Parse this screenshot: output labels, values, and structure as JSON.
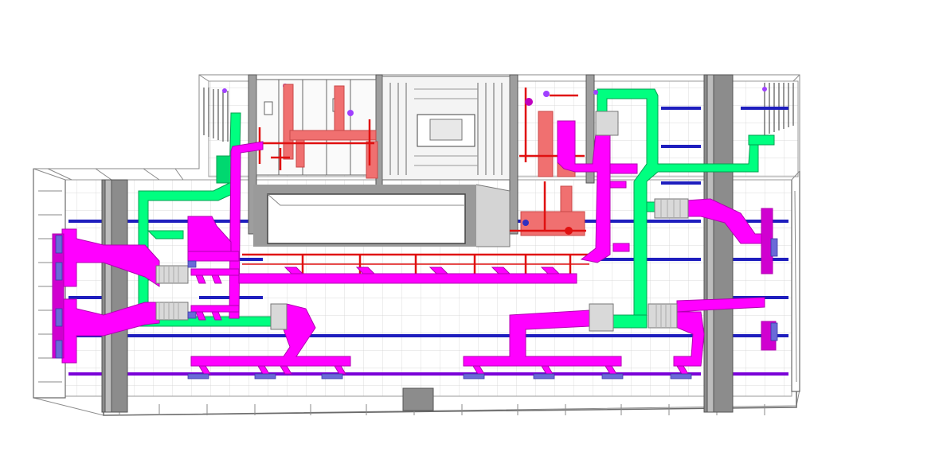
{
  "view": {
    "kind": "3D isometric BIM model - MEP ductwork floor plan",
    "visible_text": []
  },
  "colors": {
    "background": "#ffffff",
    "structure_line": "#8a8a8a",
    "core_column": "#8c8c8c",
    "core_column_light": "#bdbdbd",
    "supply_duct": "#ff00ff",
    "supply_duct_shade": "#c000c0",
    "return_duct": "#00ff80",
    "return_duct_shade": "#00b85c",
    "exhaust_duct": "#f07070",
    "exhaust_duct_shade": "#c84848",
    "pipe_red": "#e01010",
    "beam_blue": "#1e1ebe",
    "beam_violet": "#7a00d8",
    "diffuser": "#6a6ad8",
    "equipment_grey": "#d9d9d9"
  },
  "systems": [
    {
      "id": "supply-air",
      "icon": "magenta-duct"
    },
    {
      "id": "return-air",
      "icon": "green-duct"
    },
    {
      "id": "exhaust-air",
      "icon": "salmon-duct"
    },
    {
      "id": "piping",
      "icon": "red-pipe"
    }
  ]
}
